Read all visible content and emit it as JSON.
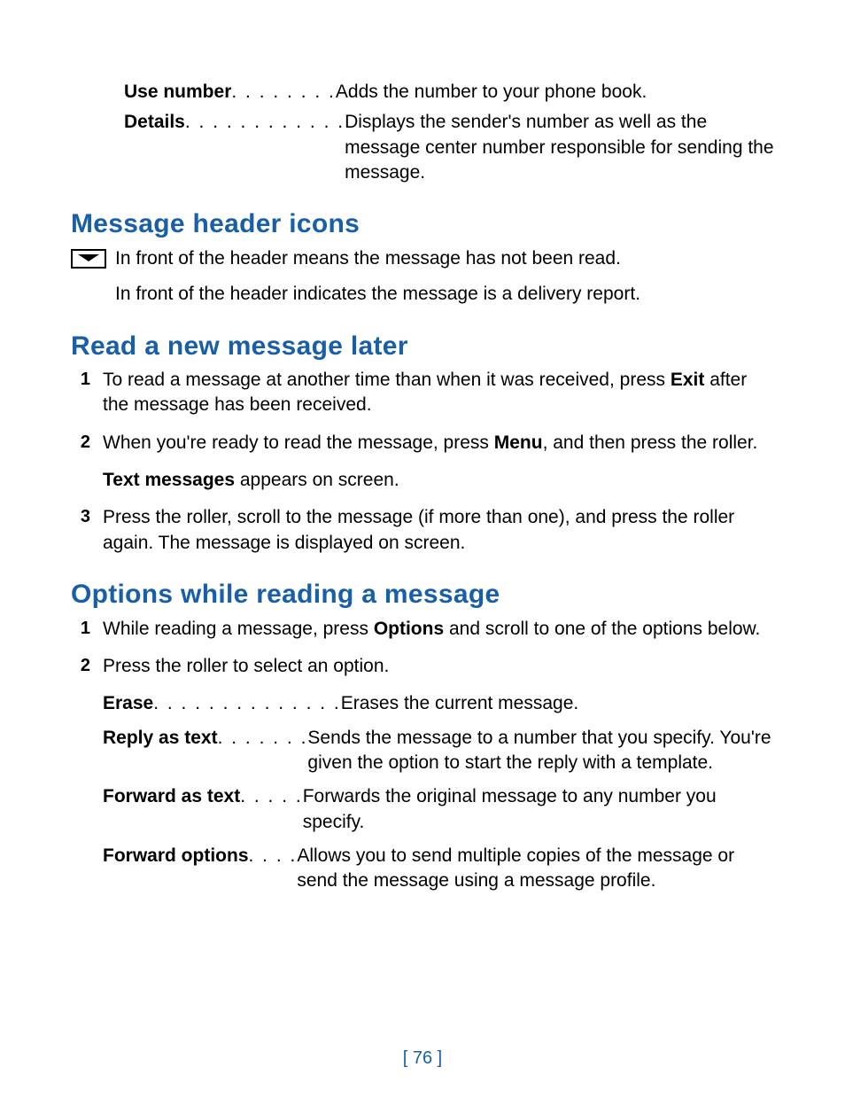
{
  "top_defs": [
    {
      "term": "Use number",
      "dots": ". . . . . . . .",
      "desc": "Adds the number to your phone book."
    },
    {
      "term": "Details",
      "dots": ". . . . . . . . . . . .",
      "desc": "Displays the sender's number as well as the message center number responsible for sending the message."
    }
  ],
  "section_icons_heading": "Message header icons",
  "icon_line_1": "In front of the header means the message has not been read.",
  "icon_line_2": "In front of the header indicates the message is a delivery report.",
  "section_read_heading": "Read a new message later",
  "read_steps": {
    "s1_pre": "To read a message at another time than when it was received, press ",
    "s1_bold": "Exit",
    "s1_post": " after the message has been received.",
    "s2_pre": "When you're ready to read the message, press ",
    "s2_bold": "Menu",
    "s2_post": ", and then press the roller.",
    "s2_note_bold": "Text messages",
    "s2_note_post": " appears on screen.",
    "s3": "Press the roller, scroll to the message (if more than one), and press the roller again. The message is displayed on screen."
  },
  "section_options_heading": "Options while reading a message",
  "options_steps": {
    "s1_pre": "While reading a message, press ",
    "s1_bold": "Options",
    "s1_post": " and scroll to one of the options below.",
    "s2": "Press the roller to select an option."
  },
  "option_defs": [
    {
      "term": "Erase",
      "dots": ". . . . . . . . . . . . . .",
      "desc": "Erases the current message."
    },
    {
      "term": "Reply as text",
      "dots": ". . . . . . .",
      "desc": "Sends the message to a number that you specify. You're given the option to start the reply with a template."
    },
    {
      "term": "Forward as text",
      "dots": ". . . . .",
      "desc": "Forwards the original message to any number you specify."
    },
    {
      "term": "Forward options",
      "dots": " . . . .",
      "desc": "Allows you to send multiple copies of the message or send the message using a message profile."
    }
  ],
  "page_number": "[ 76 ]",
  "nums": {
    "n1": "1",
    "n2": "2",
    "n3": "3"
  }
}
